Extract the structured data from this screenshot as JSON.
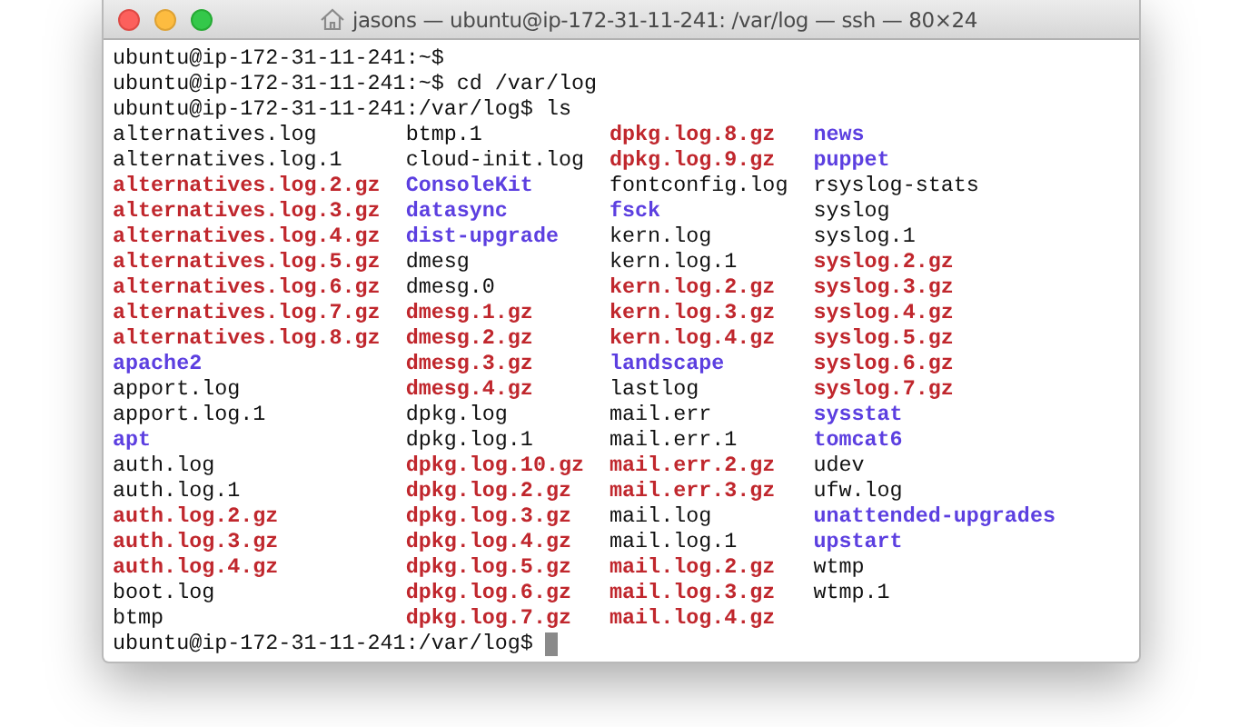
{
  "window": {
    "title": "jasons — ubuntu@ip-172-31-11-241: /var/log — ssh — 80×24"
  },
  "terminal": {
    "lines_before": [
      "ubuntu@ip-172-31-11-241:~$",
      "ubuntu@ip-172-31-11-241:~$ cd /var/log",
      "ubuntu@ip-172-31-11-241:/var/log$ ls"
    ],
    "listing": [
      [
        {
          "name": "alternatives.log",
          "kind": "file"
        },
        {
          "name": "alternatives.log.1",
          "kind": "file"
        },
        {
          "name": "alternatives.log.2.gz",
          "kind": "archive"
        },
        {
          "name": "alternatives.log.3.gz",
          "kind": "archive"
        },
        {
          "name": "alternatives.log.4.gz",
          "kind": "archive"
        },
        {
          "name": "alternatives.log.5.gz",
          "kind": "archive"
        },
        {
          "name": "alternatives.log.6.gz",
          "kind": "archive"
        },
        {
          "name": "alternatives.log.7.gz",
          "kind": "archive"
        },
        {
          "name": "alternatives.log.8.gz",
          "kind": "archive"
        },
        {
          "name": "apache2",
          "kind": "directory"
        },
        {
          "name": "apport.log",
          "kind": "file"
        },
        {
          "name": "apport.log.1",
          "kind": "file"
        },
        {
          "name": "apt",
          "kind": "directory"
        },
        {
          "name": "auth.log",
          "kind": "file"
        },
        {
          "name": "auth.log.1",
          "kind": "file"
        },
        {
          "name": "auth.log.2.gz",
          "kind": "archive"
        },
        {
          "name": "auth.log.3.gz",
          "kind": "archive"
        },
        {
          "name": "auth.log.4.gz",
          "kind": "archive"
        },
        {
          "name": "boot.log",
          "kind": "file"
        },
        {
          "name": "btmp",
          "kind": "file"
        }
      ],
      [
        {
          "name": "btmp.1",
          "kind": "file"
        },
        {
          "name": "cloud-init.log",
          "kind": "file"
        },
        {
          "name": "ConsoleKit",
          "kind": "directory"
        },
        {
          "name": "datasync",
          "kind": "directory"
        },
        {
          "name": "dist-upgrade",
          "kind": "directory"
        },
        {
          "name": "dmesg",
          "kind": "file"
        },
        {
          "name": "dmesg.0",
          "kind": "file"
        },
        {
          "name": "dmesg.1.gz",
          "kind": "archive"
        },
        {
          "name": "dmesg.2.gz",
          "kind": "archive"
        },
        {
          "name": "dmesg.3.gz",
          "kind": "archive"
        },
        {
          "name": "dmesg.4.gz",
          "kind": "archive"
        },
        {
          "name": "dpkg.log",
          "kind": "file"
        },
        {
          "name": "dpkg.log.1",
          "kind": "file"
        },
        {
          "name": "dpkg.log.10.gz",
          "kind": "archive"
        },
        {
          "name": "dpkg.log.2.gz",
          "kind": "archive"
        },
        {
          "name": "dpkg.log.3.gz",
          "kind": "archive"
        },
        {
          "name": "dpkg.log.4.gz",
          "kind": "archive"
        },
        {
          "name": "dpkg.log.5.gz",
          "kind": "archive"
        },
        {
          "name": "dpkg.log.6.gz",
          "kind": "archive"
        },
        {
          "name": "dpkg.log.7.gz",
          "kind": "archive"
        }
      ],
      [
        {
          "name": "dpkg.log.8.gz",
          "kind": "archive"
        },
        {
          "name": "dpkg.log.9.gz",
          "kind": "archive"
        },
        {
          "name": "fontconfig.log",
          "kind": "file"
        },
        {
          "name": "fsck",
          "kind": "directory"
        },
        {
          "name": "kern.log",
          "kind": "file"
        },
        {
          "name": "kern.log.1",
          "kind": "file"
        },
        {
          "name": "kern.log.2.gz",
          "kind": "archive"
        },
        {
          "name": "kern.log.3.gz",
          "kind": "archive"
        },
        {
          "name": "kern.log.4.gz",
          "kind": "archive"
        },
        {
          "name": "landscape",
          "kind": "directory"
        },
        {
          "name": "lastlog",
          "kind": "file"
        },
        {
          "name": "mail.err",
          "kind": "file"
        },
        {
          "name": "mail.err.1",
          "kind": "file"
        },
        {
          "name": "mail.err.2.gz",
          "kind": "archive"
        },
        {
          "name": "mail.err.3.gz",
          "kind": "archive"
        },
        {
          "name": "mail.log",
          "kind": "file"
        },
        {
          "name": "mail.log.1",
          "kind": "file"
        },
        {
          "name": "mail.log.2.gz",
          "kind": "archive"
        },
        {
          "name": "mail.log.3.gz",
          "kind": "archive"
        },
        {
          "name": "mail.log.4.gz",
          "kind": "archive"
        }
      ],
      [
        {
          "name": "news",
          "kind": "directory"
        },
        {
          "name": "puppet",
          "kind": "directory"
        },
        {
          "name": "rsyslog-stats",
          "kind": "file"
        },
        {
          "name": "syslog",
          "kind": "file"
        },
        {
          "name": "syslog.1",
          "kind": "file"
        },
        {
          "name": "syslog.2.gz",
          "kind": "archive"
        },
        {
          "name": "syslog.3.gz",
          "kind": "archive"
        },
        {
          "name": "syslog.4.gz",
          "kind": "archive"
        },
        {
          "name": "syslog.5.gz",
          "kind": "archive"
        },
        {
          "name": "syslog.6.gz",
          "kind": "archive"
        },
        {
          "name": "syslog.7.gz",
          "kind": "archive"
        },
        {
          "name": "sysstat",
          "kind": "directory"
        },
        {
          "name": "tomcat6",
          "kind": "directory"
        },
        {
          "name": "udev",
          "kind": "file"
        },
        {
          "name": "ufw.log",
          "kind": "file"
        },
        {
          "name": "unattended-upgrades",
          "kind": "directory"
        },
        {
          "name": "upstart",
          "kind": "directory"
        },
        {
          "name": "wtmp",
          "kind": "file"
        },
        {
          "name": "wtmp.1",
          "kind": "file"
        }
      ]
    ],
    "prompt": "ubuntu@ip-172-31-11-241:/var/log$"
  }
}
